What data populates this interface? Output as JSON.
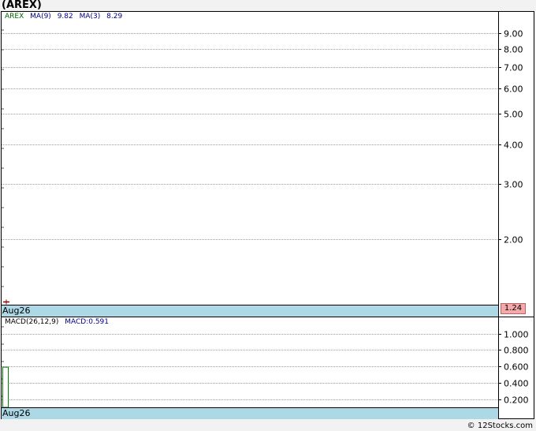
{
  "header": {
    "title": "(AREX)"
  },
  "price_panel": {
    "legend": {
      "ticker": "AREX",
      "ma9_label": "MA(9)",
      "ma9_value": "9.82",
      "ma3_label": "MA(3)",
      "ma3_value": "8.29"
    },
    "date_label": "Aug26",
    "last_price": "1.24"
  },
  "macd_panel": {
    "legend": {
      "params_label": "MACD(26,12,9)",
      "macd_value_label": "MACD:0.591"
    },
    "date_label": "Aug26"
  },
  "footer": {
    "credit": "© 12Stocks.com"
  },
  "colors": {
    "ticker_label": "#006400",
    "ma_label": "#00008b",
    "date_strip": "#add8e6",
    "badge": "#f4aaaa",
    "macd_bar": "#008000",
    "grid": "#9a9a9a"
  },
  "chart_data": [
    {
      "type": "line",
      "title": "(AREX)",
      "scale": "log",
      "ylim": [
        1.24,
        10.5
      ],
      "yticks": [
        "9.00",
        "8.00",
        "7.00",
        "6.00",
        "5.00",
        "4.00",
        "3.00",
        "2.00"
      ],
      "ytick_values": [
        9,
        8,
        7,
        6,
        5,
        4,
        3,
        2
      ],
      "x": [
        "Aug26"
      ],
      "series": [
        {
          "values": [
            1.24
          ]
        }
      ],
      "last_value": 1.24,
      "grid": true
    },
    {
      "type": "bar",
      "ylim": [
        0.1,
        1.2
      ],
      "yticks": [
        "1.000",
        "0.800",
        "0.600",
        "0.400",
        "0.200"
      ],
      "ytick_values": [
        1.0,
        0.8,
        0.6,
        0.4,
        0.2
      ],
      "x": [
        "Aug26"
      ],
      "series": [
        {
          "values": [
            0.591
          ]
        }
      ],
      "grid": true
    }
  ]
}
